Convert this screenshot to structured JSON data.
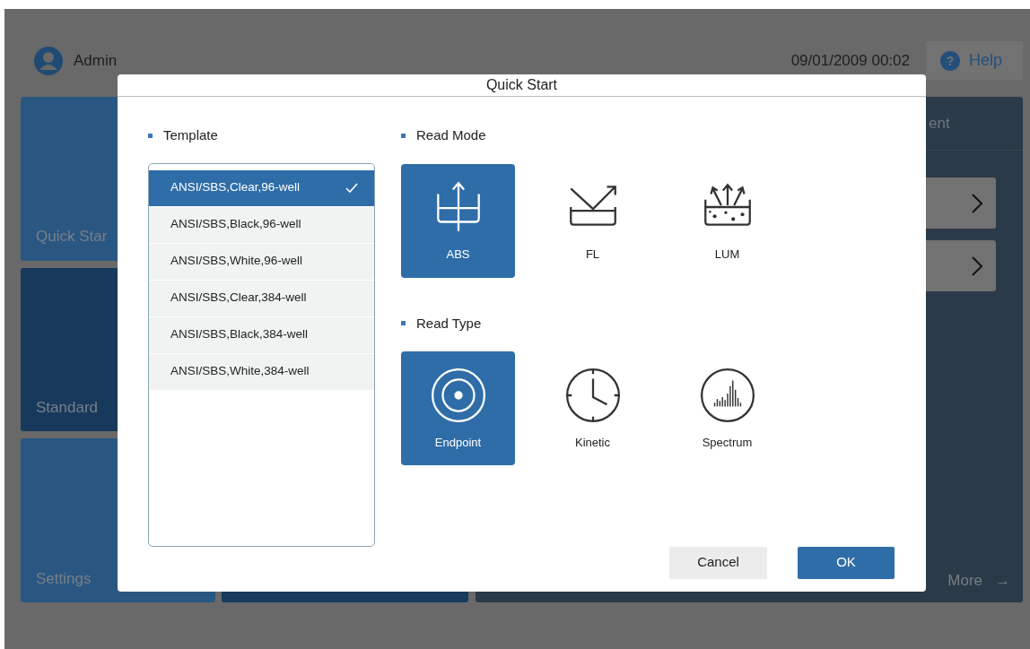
{
  "header": {
    "user": "Admin",
    "datetime": "09/01/2009 00:02",
    "help_icon": "?",
    "help": "Help"
  },
  "tiles": [
    {
      "label": "Quick Star"
    },
    {
      "label": "Standard"
    },
    {
      "label": "Settings"
    }
  ],
  "panel": {
    "title": "ent",
    "more": "More",
    "more_arrow": "→"
  },
  "dialog": {
    "title": "Quick Start",
    "template": {
      "label": "Template",
      "items": [
        {
          "label": "ANSI/SBS,Clear,96-well",
          "selected": true
        },
        {
          "label": "ANSI/SBS,Black,96-well",
          "selected": false
        },
        {
          "label": "ANSI/SBS,White,96-well",
          "selected": false
        },
        {
          "label": "ANSI/SBS,Clear,384-well",
          "selected": false
        },
        {
          "label": "ANSI/SBS,Black,384-well",
          "selected": false
        },
        {
          "label": "ANSI/SBS,White,384-well",
          "selected": false
        }
      ]
    },
    "read_mode": {
      "label": "Read Mode",
      "options": [
        {
          "label": "ABS",
          "kind": "abs",
          "selected": true
        },
        {
          "label": "FL",
          "kind": "fl",
          "selected": false
        },
        {
          "label": "LUM",
          "kind": "lum",
          "selected": false
        }
      ]
    },
    "read_type": {
      "label": "Read Type",
      "options": [
        {
          "label": "Endpoint",
          "kind": "endpoint",
          "selected": true
        },
        {
          "label": "Kinetic",
          "kind": "kinetic",
          "selected": false
        },
        {
          "label": "Spectrum",
          "kind": "spectrum",
          "selected": false
        }
      ]
    },
    "buttons": [
      {
        "label": "Cancel",
        "kind": "secondary"
      },
      {
        "label": "OK",
        "kind": "primary"
      }
    ]
  }
}
